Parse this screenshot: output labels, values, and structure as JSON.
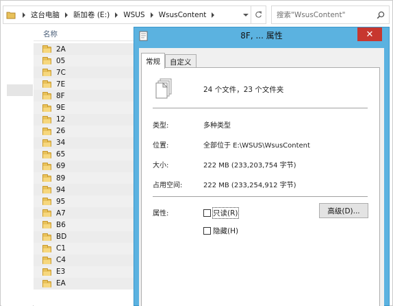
{
  "address_bar": {
    "segments": [
      "这台电脑",
      "新加卷 (E:)",
      "WSUS",
      "WsusContent"
    ]
  },
  "search": {
    "placeholder": "搜索\"WsusContent\""
  },
  "file_list": {
    "column_header": "名称",
    "items": [
      "2A",
      "05",
      "7C",
      "7E",
      "8F",
      "9E",
      "12",
      "26",
      "34",
      "65",
      "69",
      "89",
      "94",
      "95",
      "A7",
      "B6",
      "BD",
      "C1",
      "C4",
      "E3",
      "EA"
    ]
  },
  "dialog": {
    "title": "8F, ... 属性",
    "close_glyph": "✕",
    "tabs": [
      "常规",
      "自定义"
    ],
    "summary": "24 个文件，23 个文件夹",
    "details": {
      "type_label": "类型:",
      "type_value": "多种类型",
      "location_label": "位置:",
      "location_value": "全部位于 E:\\WSUS\\WsusContent",
      "size_label": "大小:",
      "size_value": "222 MB (233,203,754 字节)",
      "size_on_disk_label": "占用空间:",
      "size_on_disk_value": "222 MB (233,254,912 字节)"
    },
    "attributes": {
      "label": "属性:",
      "readonly": "只读(R)",
      "hidden": "隐藏(H)",
      "advanced_button": "高级(D)..."
    }
  },
  "colors": {
    "dialog_frame": "#5bb2e0",
    "close_button": "#c7372f",
    "folder_yellow": "#e8c15a",
    "header_text": "#4c607a"
  }
}
